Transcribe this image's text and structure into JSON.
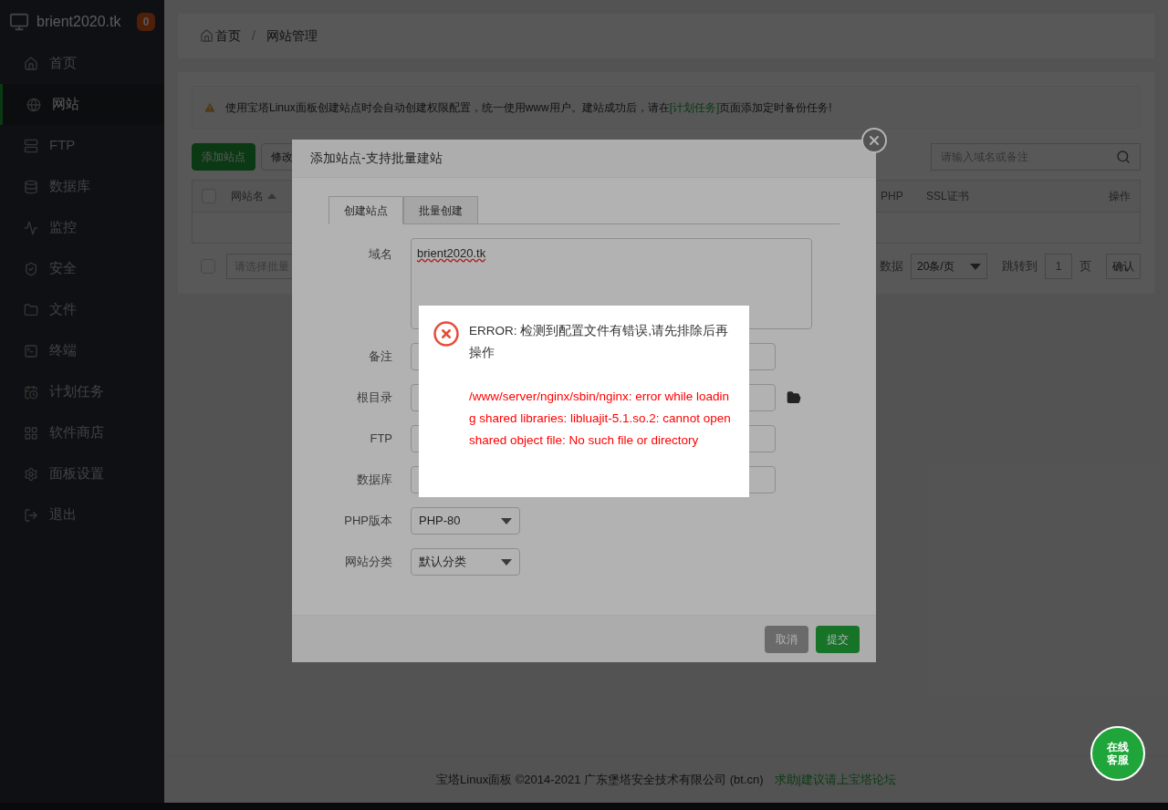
{
  "sidebar": {
    "brand": "brient2020.tk",
    "badge": "0",
    "items": [
      {
        "label": "首页",
        "selected": false
      },
      {
        "label": "网站",
        "selected": true
      },
      {
        "label": "FTP",
        "selected": false
      },
      {
        "label": "数据库",
        "selected": false
      },
      {
        "label": "监控",
        "selected": false
      },
      {
        "label": "安全",
        "selected": false
      },
      {
        "label": "文件",
        "selected": false
      },
      {
        "label": "终端",
        "selected": false
      },
      {
        "label": "计划任务",
        "selected": false
      },
      {
        "label": "软件商店",
        "selected": false
      },
      {
        "label": "面板设置",
        "selected": false
      },
      {
        "label": "退出",
        "selected": false
      }
    ]
  },
  "breadcrumb": [
    "首页",
    "/",
    "网站管理"
  ],
  "notice": {
    "before": "使用宝塔Linux面板创建站点时会自动创建权限配置，统一使用www用户。建站成功后，请在",
    "link": "[计划任务]",
    "after": "页面添加定时备份任务!"
  },
  "toolbar": {
    "buttons": [
      "添加站点",
      "修改"
    ],
    "search_placeholder": "请输入域名或备注"
  },
  "table": {
    "header_checked": false,
    "columns": [
      "网站名",
      "PHP",
      "SSL证书",
      "操作"
    ]
  },
  "footer_row": {
    "checked": false,
    "batch_placeholder": "请选择批量",
    "count_text": "数据",
    "page_size": "20条/页",
    "goto_label": "跳转到",
    "page": "1",
    "page_unit": "页",
    "confirm": "确认"
  },
  "modal": {
    "title": "添加站点-支持批量建站",
    "tabs": [
      {
        "label": "创建站点",
        "selected": true
      },
      {
        "label": "批量创建",
        "selected": false
      }
    ],
    "fields": [
      {
        "kind": "textarea",
        "label": "域名",
        "value": "brient2020.tk"
      },
      {
        "kind": "input",
        "label": "备注"
      },
      {
        "kind": "path",
        "label": "根目录"
      },
      {
        "kind": "input",
        "label": "FTP"
      },
      {
        "kind": "input",
        "label": "数据库"
      },
      {
        "kind": "select",
        "label": "PHP版本",
        "value": "PHP-80"
      },
      {
        "kind": "select",
        "label": "网站分类",
        "value": "默认分类"
      }
    ],
    "buttons": [
      {
        "label": "取消",
        "disabled": true
      },
      {
        "label": "提交",
        "disabled": false
      }
    ]
  },
  "error": {
    "title": "ERROR: 检测到配置文件有错误,请先排除后再操作",
    "detail": "/www/server/nginx/sbin/nginx: error while loading shared libraries: libluajit-5.1.so.2: cannot open shared object file: No such file or directory"
  },
  "page_footer": {
    "copyright": "宝塔Linux面板 ©2014-2021 广东堡塔安全技术有限公司 (bt.cn)",
    "link": "求助|建议请上宝塔论坛"
  },
  "chat_button": "在线客服"
}
